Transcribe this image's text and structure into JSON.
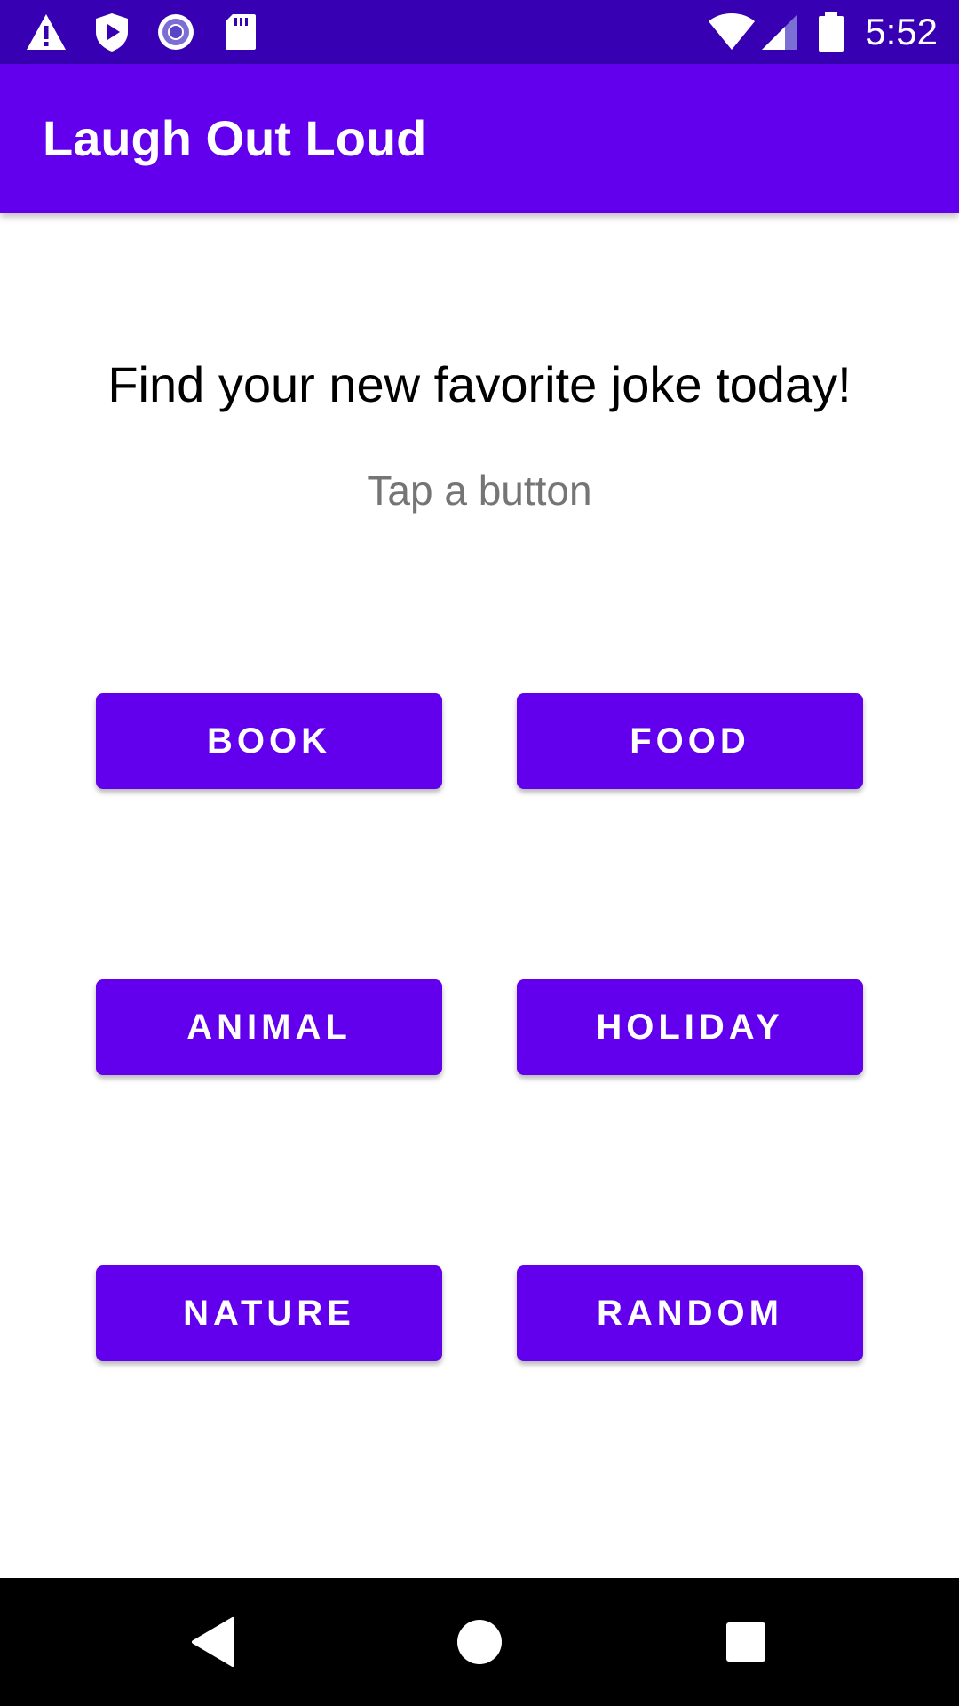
{
  "status_bar": {
    "time": "5:52",
    "icons_left": [
      "warning-icon",
      "play-protect-icon",
      "radio-icon",
      "sd-card-icon"
    ],
    "icons_right": [
      "wifi-icon",
      "signal-icon",
      "battery-icon"
    ],
    "background_color": "#3700b3"
  },
  "app_bar": {
    "title": "Laugh Out Loud",
    "background_color": "#6200ee"
  },
  "main": {
    "headline": "Find your new favorite joke today!",
    "subtitle": "Tap a button",
    "buttons": [
      {
        "label": "BOOK"
      },
      {
        "label": "FOOD"
      },
      {
        "label": "ANIMAL"
      },
      {
        "label": "HOLIDAY"
      },
      {
        "label": "NATURE"
      },
      {
        "label": "RANDOM"
      }
    ],
    "button_color": "#6200ee"
  },
  "nav_bar": {
    "icons": [
      "back-icon",
      "home-icon",
      "recents-icon"
    ]
  }
}
